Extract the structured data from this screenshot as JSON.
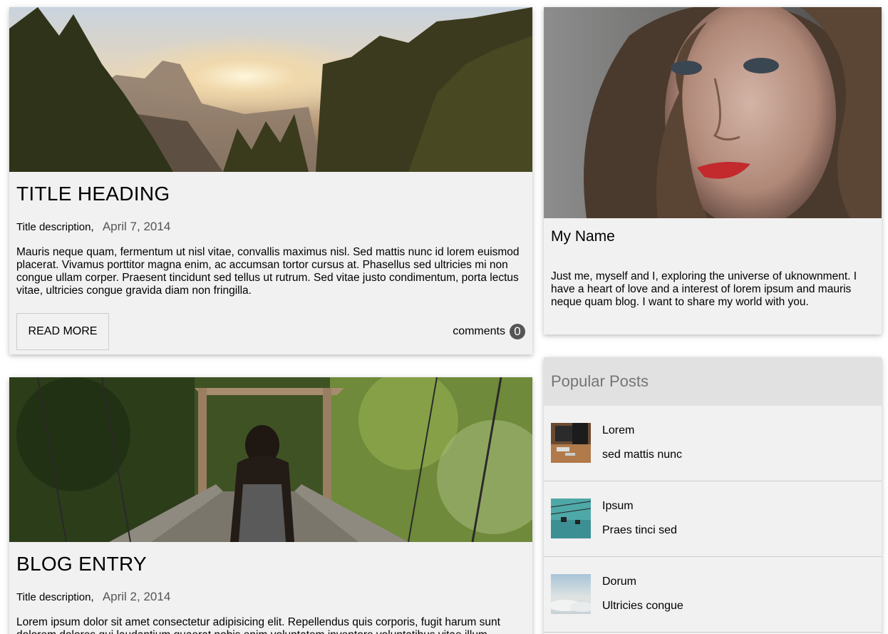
{
  "posts": [
    {
      "title": "TITLE HEADING",
      "description": "Title description,",
      "date": "April 7, 2014",
      "text": "Mauris neque quam, fermentum ut nisl vitae, convallis maximus nisl. Sed mattis nunc id lorem euismod placerat. Vivamus porttitor magna enim, ac accumsan tortor cursus at. Phasellus sed ultricies mi non congue ullam corper. Praesent tincidunt sed tellus ut rutrum. Sed vitae justo condimentum, porta lectus vitae, ultricies congue gravida diam non fringilla.",
      "read_more": "READ MORE",
      "comments_label": "comments",
      "comments_count": "0"
    },
    {
      "title": "BLOG ENTRY",
      "description": "Title description,",
      "date": "April 2, 2014",
      "text": "Lorem ipsum dolor sit amet consectetur adipisicing elit. Repellendus quis corporis, fugit harum sunt dolorem dolores qui laudantium quaerat nobis enim voluptatem inventore voluptatibus vitae illum."
    }
  ],
  "profile": {
    "name": "My Name",
    "bio": "Just me, myself and I, exploring the universe of uknownment. I have a heart of love and a interest of lorem ipsum and mauris neque quam blog. I want to share my world with you."
  },
  "popular": {
    "heading": "Popular Posts",
    "items": [
      {
        "title": "Lorem",
        "subtitle": "sed mattis nunc",
        "icon": "workspace-thumb"
      },
      {
        "title": "Ipsum",
        "subtitle": "Praes tinci sed",
        "icon": "cablecar-thumb"
      },
      {
        "title": "Dorum",
        "subtitle": "Ultricies congue",
        "icon": "clouds-thumb"
      }
    ]
  },
  "colors": {
    "card_bg": "#f1f1f1",
    "popular_head_bg": "#e1e1e1",
    "badge_bg": "#555555"
  }
}
